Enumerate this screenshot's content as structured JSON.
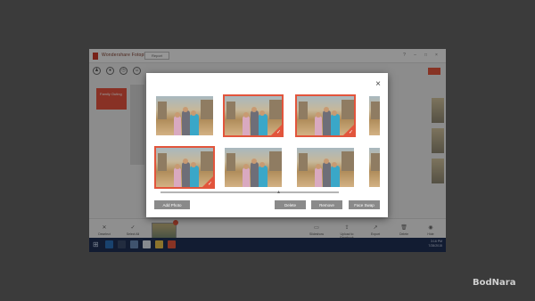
{
  "app": {
    "title": "Wondershare Fotophire",
    "report_label": "Report",
    "window_controls": [
      "?",
      "–",
      "□",
      "×"
    ],
    "new_album_label": "Family Outing"
  },
  "toolbar_icons": [
    "person-icon",
    "location-icon",
    "clock-icon",
    "face-icon"
  ],
  "modal": {
    "close_label": "×",
    "photos": [
      {
        "selected": false
      },
      {
        "selected": true
      },
      {
        "selected": true
      },
      {
        "selected": false
      },
      {
        "selected": true
      },
      {
        "selected": false
      },
      {
        "selected": false
      },
      {
        "selected": false
      }
    ],
    "buttons": {
      "add_photo": "Add Photo",
      "delete": "Delete",
      "remove": "Remove",
      "face_swap": "Face Swap"
    }
  },
  "bottombar": {
    "items": [
      {
        "label": "Deselect",
        "icon": "✕"
      },
      {
        "label": "Select All",
        "icon": "✓"
      },
      {
        "label": "Slideshow",
        "icon": "▭"
      },
      {
        "label": "Upload to Facebook",
        "icon": "⇪"
      },
      {
        "label": "Export",
        "icon": "↗"
      },
      {
        "label": "Delete",
        "icon": "🗑"
      },
      {
        "label": "Hide",
        "icon": "◉"
      }
    ],
    "selected_count": ""
  },
  "taskbar": {
    "time": "3:16 PM",
    "date": "7/28/2015"
  },
  "watermark": "BodNara",
  "colors": {
    "accent": "#e2553c",
    "button_gray": "#8a8a8a"
  }
}
